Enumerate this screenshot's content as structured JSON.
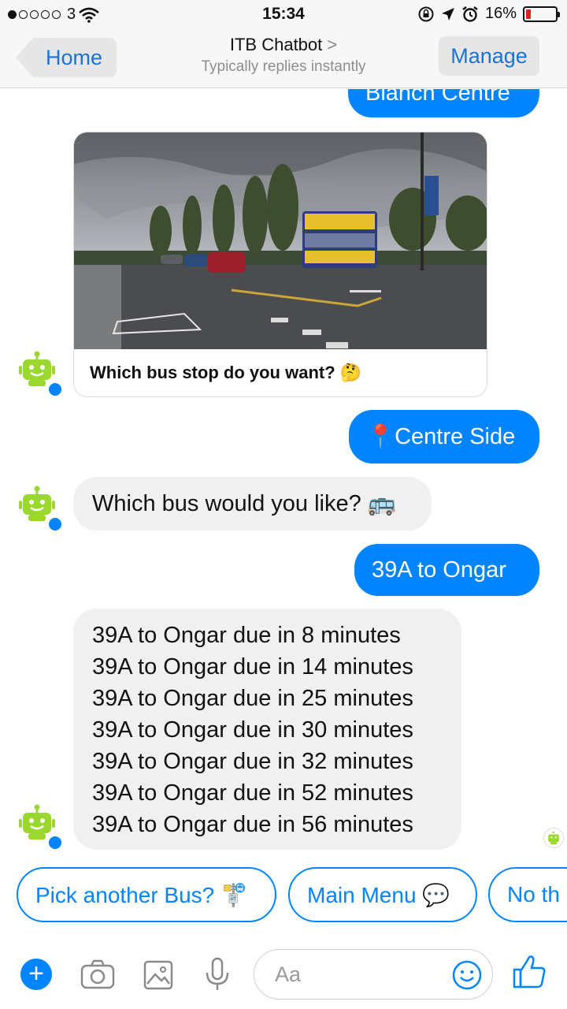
{
  "status_bar": {
    "carrier": "3",
    "time": "15:34",
    "battery": "16%",
    "battery_level": 0.16
  },
  "nav": {
    "back_label": "Home",
    "title": "ITB Chatbot",
    "chevron": ">",
    "subtitle": "Typically replies instantly",
    "manage_label": "Manage"
  },
  "messages": {
    "top_partial": "Blanch Centre",
    "card_caption": "Which bus stop do you want? 🤔",
    "reply_stop": "📍Centre Side",
    "bot_ask_bus": "Which bus would you like? 🚌",
    "reply_bus": "39A to Ongar",
    "times": [
      "39A to Ongar due in 8 minutes",
      "39A to Ongar due in 14 minutes",
      "39A to Ongar due in 25 minutes",
      "39A to Ongar due in 30 minutes",
      "39A to Ongar due in 32 minutes",
      "39A to Ongar due in 52 minutes",
      "39A to Ongar due in 56 minutes"
    ]
  },
  "quick_replies": [
    "Pick another Bus? 🚏",
    "Main Menu 💬",
    "No th"
  ],
  "composer": {
    "placeholder": "Aa"
  },
  "colors": {
    "accent": "#0084ff",
    "bot_green": "#9bd82f",
    "incoming_bubble": "#f1f0f0"
  }
}
